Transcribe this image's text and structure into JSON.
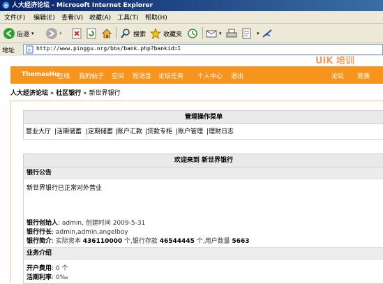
{
  "window": {
    "title": "人大经济论坛 - Microsoft Internet Explorer"
  },
  "menubar": {
    "items": [
      "文件(F)",
      "编辑(E)",
      "查看(V)",
      "收藏(A)",
      "工具(T)",
      "帮助(H)"
    ]
  },
  "toolbar": {
    "back_label": "后退",
    "search_label": "搜索",
    "favorites_label": "收藏夹"
  },
  "address": {
    "label": "地址",
    "url": "http://www.pinggu.org/bbs/bank.php?bankid=1"
  },
  "site_nav": {
    "items": [
      "ThomasHu",
      "在线",
      "我的帖子",
      "空间",
      "短消息",
      "论坛任务",
      "个人中心",
      "退出"
    ],
    "right_items": [
      "论坛",
      "竞赛"
    ]
  },
  "breadcrumb": {
    "forum": "人大经济论坛",
    "sep": "»",
    "section": "社区银行",
    "current": "新世界银行"
  },
  "admin_menu": {
    "title": "管理操作菜单",
    "items": [
      "营业大厅",
      "|活期储蓄",
      "|定期储蓄",
      "|账户汇款",
      "|贷款专柜",
      "|账户管理",
      "|理财日志"
    ]
  },
  "bank_panel": {
    "title": "欢迎来到  新世界银行",
    "notice_heading": "银行公告",
    "notice_text": "新世界银行已正常对外营业",
    "founder_label": "银行创始人",
    "founder_value": ": admin, 创建时间  2009-5-31",
    "president_label": "银行行长",
    "president_value": ": admin,admin,angelboy",
    "intro_label": "银行简介",
    "intro_prefix": ": 实际资本 ",
    "capital": "436110000",
    "deposits_mid": " 个,银行存款 ",
    "deposits": "46544445",
    "users_mid": " 个,用户数量 ",
    "users": "5663",
    "business_heading": "业务介绍",
    "fee_label": "开户费用",
    "fee_value": ": 0 个",
    "rate_label": "活期利率",
    "rate_value": ": 0‰"
  }
}
